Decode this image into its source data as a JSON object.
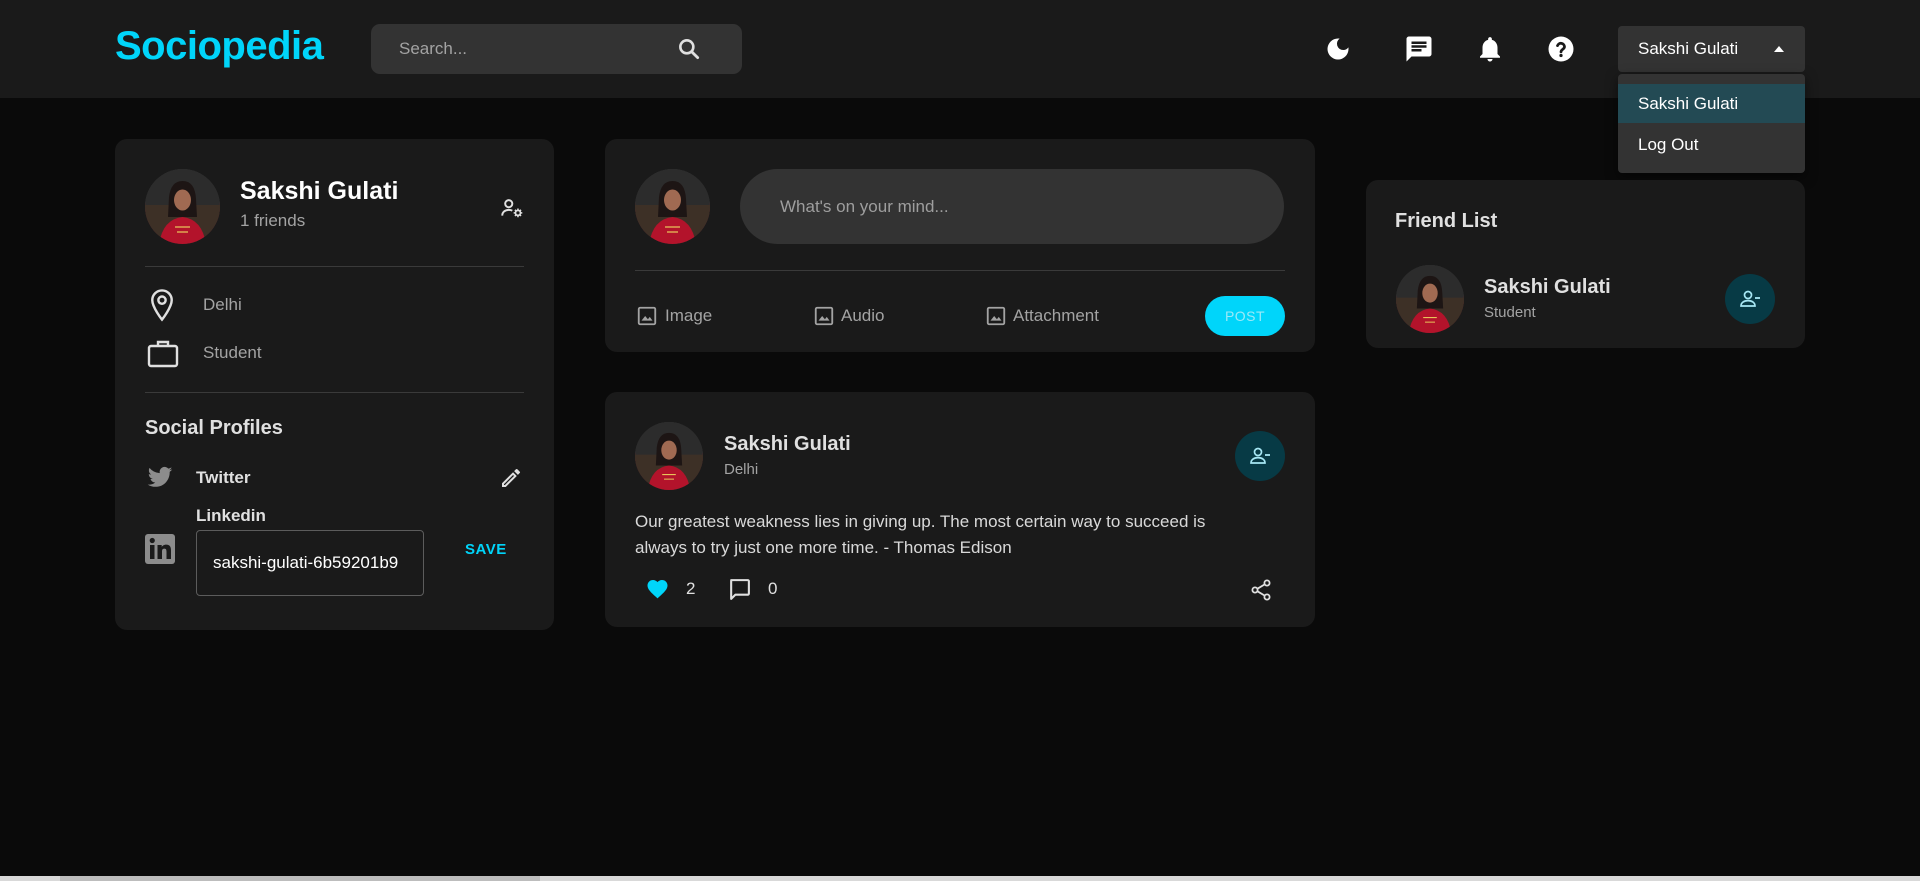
{
  "app": {
    "name": "Sociopedia",
    "accent_color": "#00d5fa"
  },
  "navbar": {
    "search_placeholder": "Search...",
    "icons": [
      "dark-mode-icon",
      "message-icon",
      "notification-icon",
      "help-icon"
    ],
    "user_select": {
      "selected": "Sakshi Gulati",
      "options": [
        "Sakshi Gulati",
        "Log Out"
      ]
    }
  },
  "profile_card": {
    "name": "Sakshi Gulati",
    "friends": "1 friends",
    "location": "Delhi",
    "occupation": "Student",
    "social_title": "Social Profiles",
    "twitter_label": "Twitter",
    "linkedin_label": "Linkedin",
    "linkedin_value": "sakshi-gulati-6b59201b9",
    "save_label": "SAVE"
  },
  "create_post": {
    "placeholder": "What's on your mind...",
    "image_label": "Image",
    "audio_label": "Audio",
    "attachment_label": "Attachment",
    "post_label": "POST"
  },
  "post": {
    "author": "Sakshi Gulati",
    "location": "Delhi",
    "text_line1": "Our greatest weakness lies in giving up. The most certain way to succeed is",
    "text_line2": "always to try just one more time. - Thomas Edison",
    "likes": "2",
    "comments": "0"
  },
  "friend_list": {
    "title": "Friend List",
    "friends": [
      {
        "name": "Sakshi Gulati",
        "subtitle": "Student"
      }
    ]
  }
}
